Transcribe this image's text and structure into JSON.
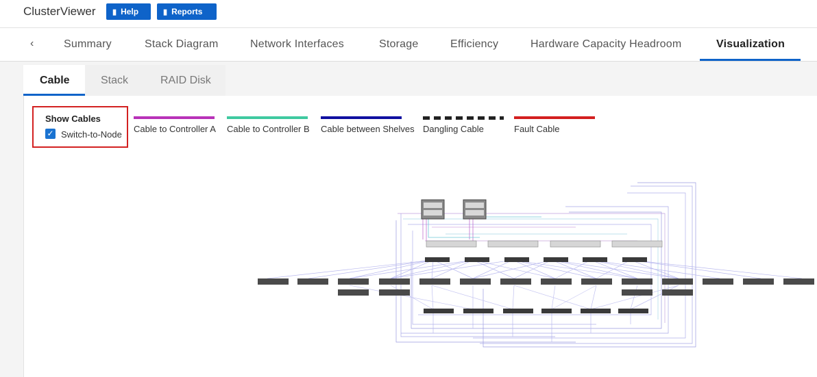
{
  "header": {
    "app_title": "ClusterViewer",
    "help_label": "Help",
    "reports_label": "Reports",
    "help_icon": "book-icon",
    "reports_icon": "bar-chart-icon",
    "accent_color": "#0e63c9"
  },
  "main_tabs": {
    "prev_icon": "chevron-left-icon",
    "items": [
      {
        "label": "Summary"
      },
      {
        "label": "Stack Diagram"
      },
      {
        "label": "Network Interfaces"
      },
      {
        "label": "Storage"
      },
      {
        "label": "Efficiency"
      },
      {
        "label": "Hardware Capacity Headroom"
      },
      {
        "label": "Visualization"
      }
    ],
    "active": "Visualization"
  },
  "sub_tabs": {
    "items": [
      {
        "label": "Cable"
      },
      {
        "label": "Stack"
      },
      {
        "label": "RAID Disk"
      }
    ],
    "active": "Cable"
  },
  "show_cables": {
    "title": "Show Cables",
    "option_label": "Switch-to-Node",
    "checked": true
  },
  "legend": [
    {
      "label": "Cable to Controller A",
      "color": "#b832b8",
      "style": "solid"
    },
    {
      "label": "Cable to Controller B",
      "color": "#3fc9a0",
      "style": "solid"
    },
    {
      "label": "Cable between Shelves",
      "color": "#1010a0",
      "style": "solid"
    },
    {
      "label": "Dangling Cable",
      "color": "#222222",
      "style": "dashed"
    },
    {
      "label": "Fault Cable",
      "color": "#d32020",
      "style": "solid"
    }
  ]
}
